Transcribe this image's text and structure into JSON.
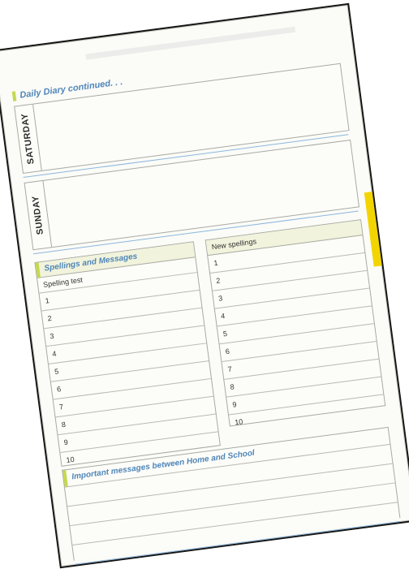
{
  "diary": {
    "title": "Daily Diary continued. . ."
  },
  "days": [
    {
      "label": "SATURDAY"
    },
    {
      "label": "SUNDAY"
    }
  ],
  "spellings": {
    "section_title": "Spellings and Messages",
    "test_header": "Spelling test",
    "test_rows": [
      "1",
      "2",
      "3",
      "4",
      "5",
      "6",
      "7",
      "8",
      "9",
      "10"
    ],
    "new_header": "New spellings",
    "new_rows": [
      "1",
      "2",
      "3",
      "4",
      "5",
      "6",
      "7",
      "8",
      "9",
      "10"
    ]
  },
  "messages": {
    "title": "Important messages between Home and School",
    "line_count": 4
  },
  "colors": {
    "accent_green": "#c6d84d",
    "heading_blue": "#4f86b9",
    "tab_yellow": "#f2d500"
  }
}
